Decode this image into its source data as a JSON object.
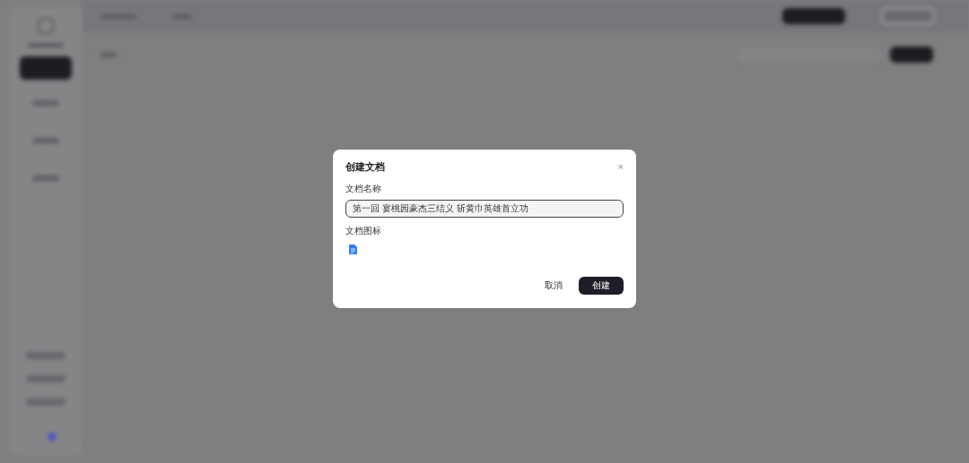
{
  "dialog": {
    "title": "创建文档",
    "close": "×",
    "name_label": "文档名称",
    "name_value": "第一回 宴桃园豪杰三结义 斩黄巾英雄首立功",
    "icon_label": "文档图标",
    "buttons": [
      {
        "label": "取消",
        "kind": "text"
      },
      {
        "label": "创建",
        "kind": "primary"
      }
    ]
  }
}
